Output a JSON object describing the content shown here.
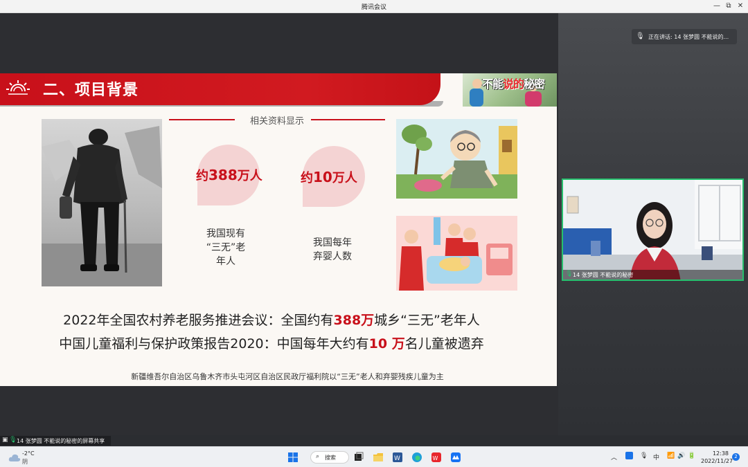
{
  "window": {
    "title": "腾讯会议",
    "controls": {
      "minimize": "—",
      "restore": "⧉",
      "close": "✕"
    }
  },
  "slide": {
    "heading": "二、项目背景",
    "logo_text_a": "不能",
    "logo_text_b": "说的",
    "logo_text_c": "秘密",
    "subheading": "相关资料显示",
    "stats": [
      {
        "prefix": "约",
        "number": "388",
        "suffix": "万人",
        "label_lines": [
          "我国现有",
          "“三无”老",
          "年人"
        ]
      },
      {
        "prefix": "约",
        "number": "10",
        "suffix": "万人",
        "label_lines": [
          "我国每年",
          "弃婴人数"
        ]
      }
    ],
    "paragraphs": [
      {
        "before": "2022年全国农村养老服务推进会议：全国约有",
        "highlight": "388万",
        "after": "城乡“三无”老年人"
      },
      {
        "before": "中国儿童福利与保护政策报告2020：中国每年大约有",
        "highlight": "10 万",
        "after": "名儿童被遗弃"
      }
    ],
    "footnote": "新疆维吾尔自治区乌鲁木齐市头屯河区自治区民政厅福利院以“三无”老人和弃婴残疾儿童为主"
  },
  "speaking_tag": "正在讲话: 14 张梦圆 不能说的...",
  "video_tile": {
    "name": "14 张梦圆 不能说的秘密"
  },
  "share_tag": "14 张梦圆 不能说的秘密的屏幕共享",
  "taskbar": {
    "weather_temp": "-2°C",
    "weather_cond": "阴",
    "search_label": "搜索",
    "ime": "中",
    "time": "12:38",
    "date": "2022/11/27",
    "notification_count": "2"
  },
  "colors": {
    "accent_red": "#c8101a",
    "speaking_green": "#27c06e"
  }
}
